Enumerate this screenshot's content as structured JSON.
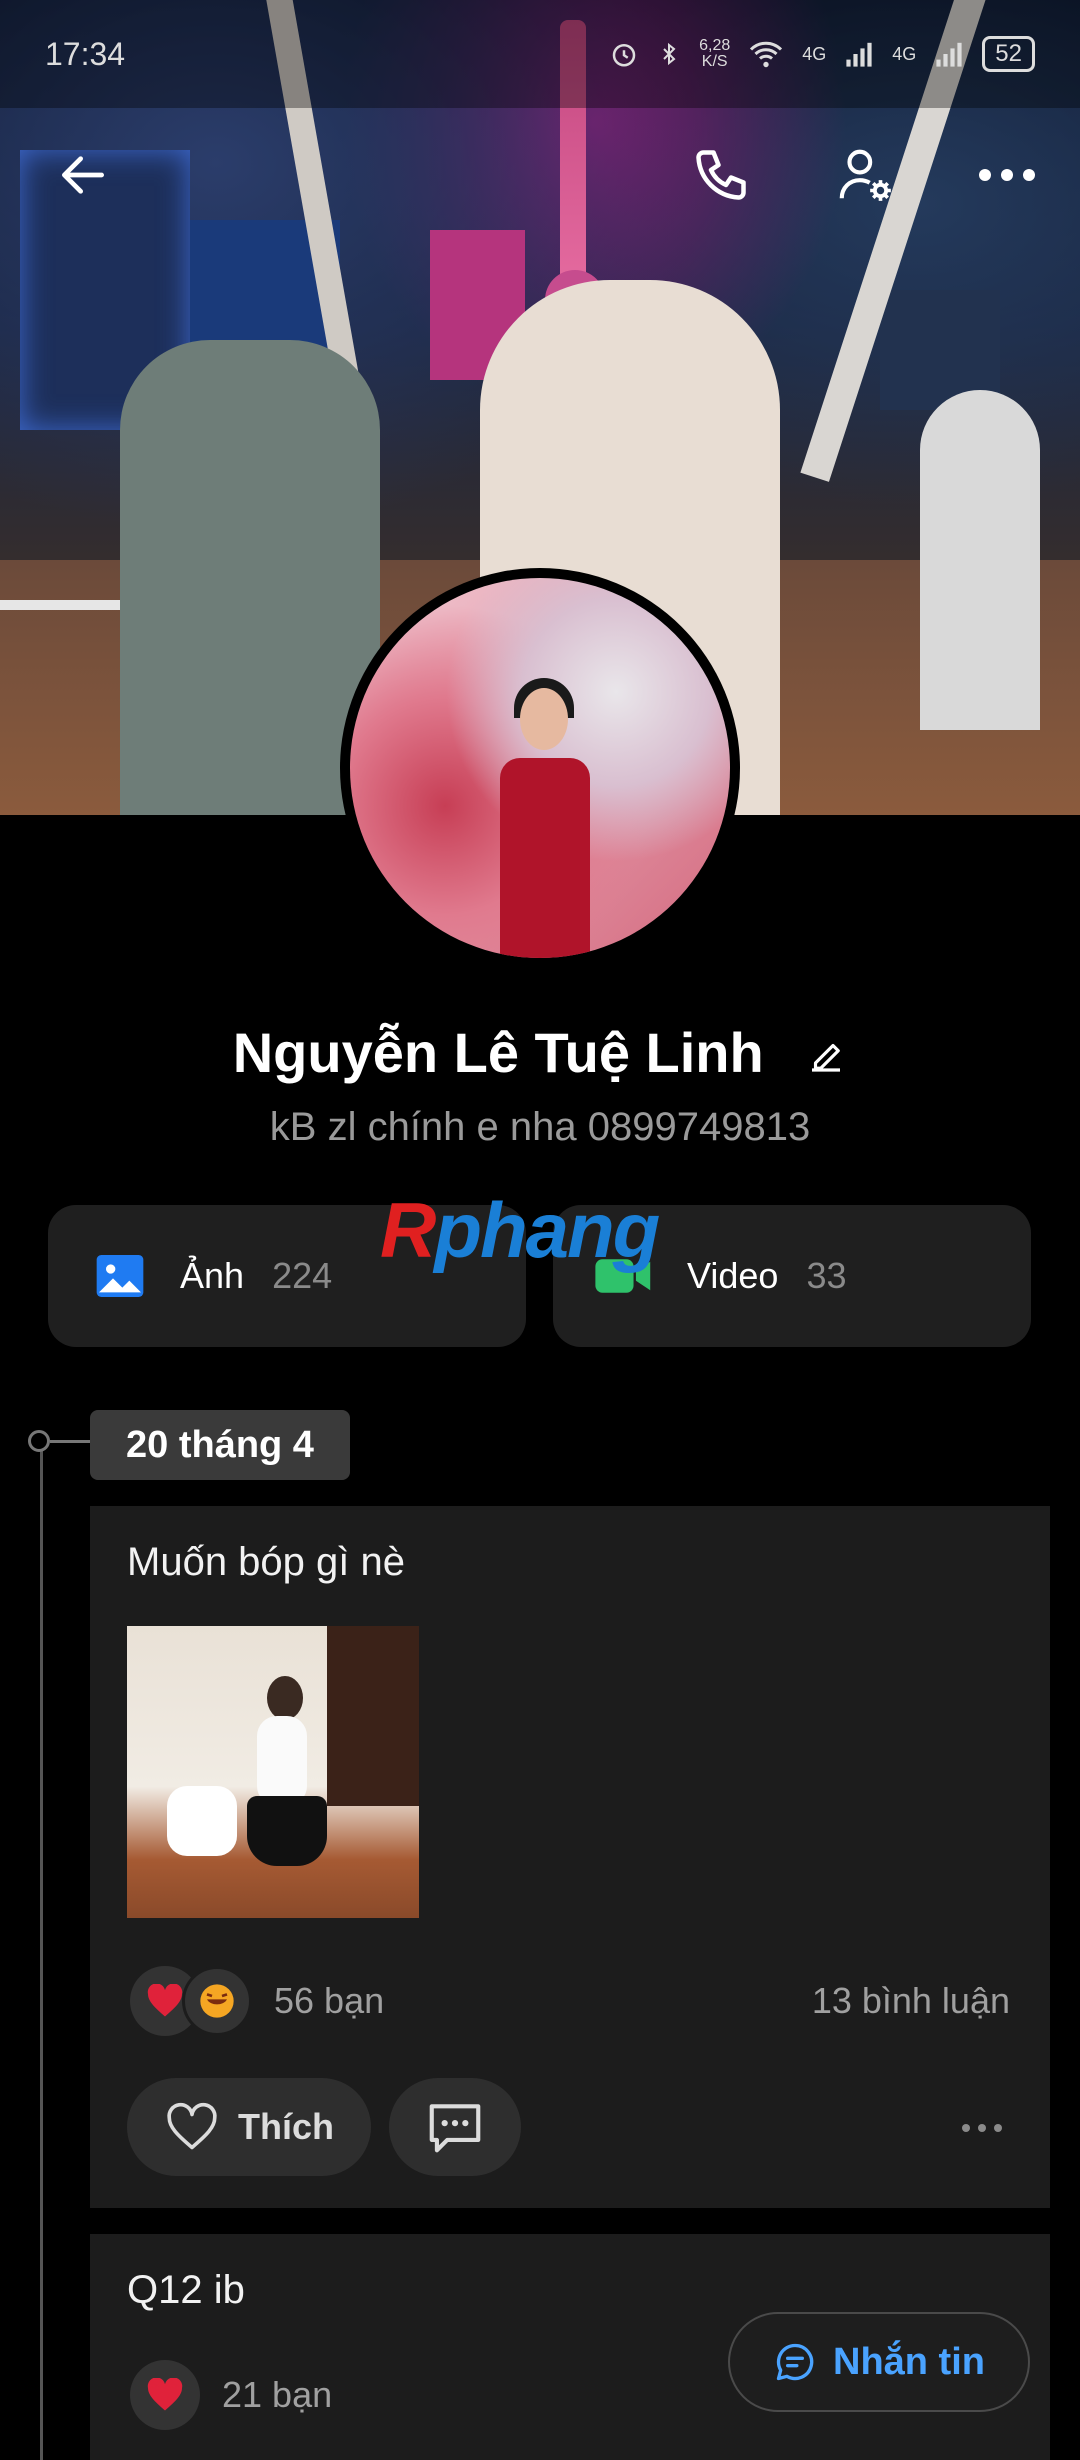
{
  "status_bar": {
    "time": "17:34",
    "net_speed": "6,28\nK/S",
    "signal1": "4G",
    "signal2": "4G",
    "battery": "52"
  },
  "nav": {
    "back_icon": "arrow-left-icon",
    "call_icon": "phone-icon",
    "settings_icon": "user-settings-icon",
    "more_icon": "more-horizontal-icon"
  },
  "profile": {
    "name": "Nguyễn Lê Tuệ Linh",
    "bio": "kB zl chính e nha 0899749813"
  },
  "media": {
    "photos_label": "Ảnh",
    "photos_count": "224",
    "videos_label": "Video",
    "videos_count": "33"
  },
  "watermark": {
    "first": "R",
    "rest": "phang"
  },
  "timeline": {
    "date": "20 tháng 4"
  },
  "posts": [
    {
      "text": "Muốn bóp gì nè",
      "reactions_count": "56 bạn",
      "comments": "13 bình luận",
      "like_label": "Thích"
    },
    {
      "text": "Q12 ib",
      "reactions_count": "21 bạn"
    }
  ],
  "fab": {
    "label": "Nhắn tin"
  },
  "colors": {
    "accent_blue": "#4aa3ff",
    "video_green": "#2fc26b",
    "photo_blue": "#1f7bf2",
    "heart_red": "#e0223a"
  }
}
